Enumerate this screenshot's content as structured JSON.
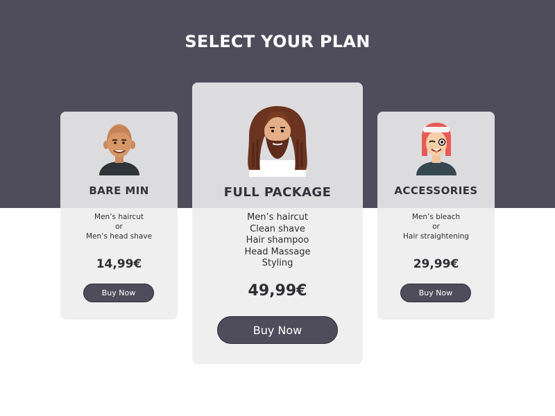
{
  "page": {
    "title": "SELECT YOUR PLAN"
  },
  "colors": {
    "band": "#4f4d5b",
    "button": "#4f4d5b",
    "card_head": "#dcdcdf",
    "card_body": "#efefef"
  },
  "plans": [
    {
      "name": "BARE MIN",
      "avatar_icon": "bald-man-avatar-icon",
      "features": [
        "Men’s haircut",
        "or",
        "Men’s head shave"
      ],
      "price": "14,99€",
      "button_label": "Buy Now"
    },
    {
      "name": "FULL PACKAGE",
      "avatar_icon": "long-haired-bearded-man-avatar-icon",
      "features": [
        "Men’s haircut",
        "Clean shave",
        "Hair shampoo",
        "Head Massage",
        "Styling"
      ],
      "price": "49,99€",
      "button_label": "Buy Now"
    },
    {
      "name": "ACCESSORIES",
      "avatar_icon": "winking-red-haired-person-avatar-icon",
      "features": [
        "Men’s bleach",
        "or",
        "Hair straightening"
      ],
      "price": "29,99€",
      "button_label": "Buy Now"
    }
  ]
}
